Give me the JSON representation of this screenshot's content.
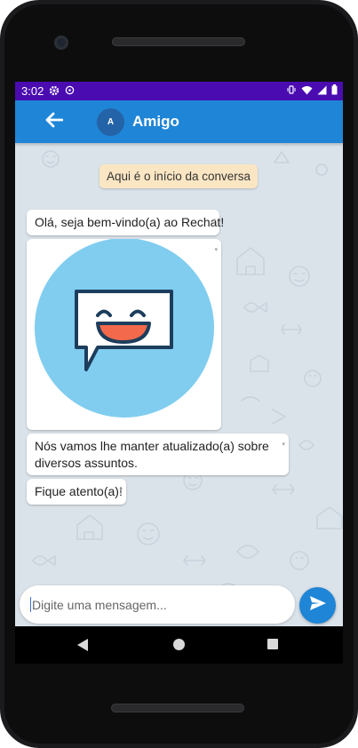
{
  "status_bar": {
    "time": "3:02",
    "left_icons": [
      "gear-icon",
      "whatsapp-icon"
    ],
    "right_icons": [
      "vibrate-icon",
      "wifi-icon",
      "signal-icon",
      "battery-icon"
    ]
  },
  "header": {
    "avatar_letter": "A",
    "contact_name": "Amigo",
    "back_icon": "arrow-left-icon"
  },
  "chat": {
    "system_message": "Aqui é o início da conversa",
    "messages": [
      {
        "type": "text",
        "text": "Olá, seja bem-vindo(a) ao Rechat!"
      },
      {
        "type": "image",
        "image": "smiling-chat-bubble-logo"
      },
      {
        "type": "text",
        "text": "Nós vamos lhe manter atualizado(a) sobre diversos assuntos."
      },
      {
        "type": "text",
        "text": "Fique atento(a)!"
      }
    ]
  },
  "composer": {
    "placeholder": "Digite uma mensagem...",
    "value": "",
    "send_icon": "send-icon"
  },
  "colors": {
    "status_bar": "#4a0cb0",
    "app_bar": "#1f85d6",
    "avatar": "#2463a7",
    "system_bubble": "#fbe6c3",
    "chat_background": "#dbe3ea",
    "logo_circle": "#80cdf0",
    "logo_mouth": "#f26a4b",
    "logo_outline": "#1d3d5c"
  },
  "nav": {
    "back_icon": "nav-back-icon",
    "home_icon": "nav-home-icon",
    "recent_icon": "nav-recent-icon"
  }
}
